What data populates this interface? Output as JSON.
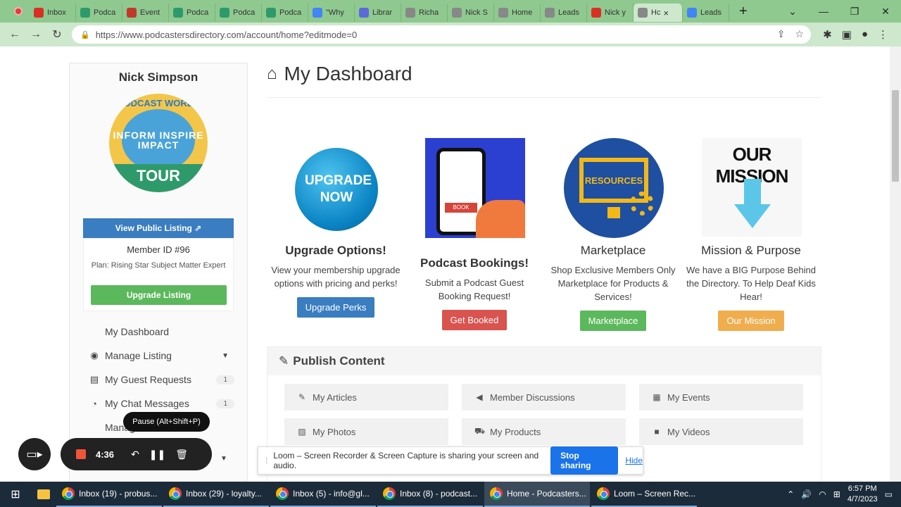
{
  "browser": {
    "tabs": [
      {
        "label": "Inbox",
        "color": "#d93025"
      },
      {
        "label": "Podca",
        "color": "#2e9a6b"
      },
      {
        "label": "Event",
        "color": "#c0392b"
      },
      {
        "label": "Podca",
        "color": "#2e9a6b"
      },
      {
        "label": "Podca",
        "color": "#2e9a6b"
      },
      {
        "label": "Podca",
        "color": "#2e9a6b"
      },
      {
        "label": "\"Why",
        "color": "#4285f4"
      },
      {
        "label": "Librar",
        "color": "#5b6bd8"
      },
      {
        "label": "Richa",
        "color": "#888888"
      },
      {
        "label": "Nick S",
        "color": "#888888"
      },
      {
        "label": "Home",
        "color": "#888888"
      },
      {
        "label": "Leads",
        "color": "#888888"
      },
      {
        "label": "Nick y",
        "color": "#d93025"
      },
      {
        "label": "Hc",
        "color": "#888888",
        "active": true
      },
      {
        "label": "Leads",
        "color": "#4285f4"
      }
    ],
    "url": "https://www.podcastersdirectory.com/account/home?editmode=0",
    "new_tab": "+",
    "close_tab": "×"
  },
  "sidebar": {
    "profile_name": "Nick Simpson",
    "logo": {
      "arc": "PODCAST WORLD",
      "lines": "INFORM INSPIRE IMPACT",
      "tour": "TOUR"
    },
    "view_public_listing": "View Public Listing",
    "member_id": "Member ID #96",
    "plan": "Plan: Rising Star Subject Matter Expert",
    "upgrade_listing": "Upgrade Listing",
    "menu": [
      {
        "label": "My Dashboard",
        "icon": "none"
      },
      {
        "label": "Manage Listing",
        "icon": "user-circle-icon"
      },
      {
        "label": "My Guest Requests",
        "icon": "id-card-icon",
        "badge": "1"
      },
      {
        "label": "My Chat Messages",
        "icon": "chat-icon",
        "badge": "1"
      },
      {
        "label": "Manage Reviews",
        "icon": "none"
      }
    ]
  },
  "main": {
    "title": "My Dashboard",
    "cards": [
      {
        "image_text": "UPGRADE NOW",
        "title": "Upgrade Options!",
        "desc": "View your membership upgrade options with pricing and perks!",
        "button": "Upgrade Perks",
        "color": "#3a7dc0"
      },
      {
        "image_text": "BOOK",
        "title": "Podcast Bookings!",
        "desc": "Submit a Podcast Guest Booking Request!",
        "button": "Get Booked",
        "color": "#d9534f"
      },
      {
        "image_text": "RESOURCES",
        "title": "Marketplace",
        "desc": "Shop Exclusive Members Only Marketplace for Products & Services!",
        "button": "Marketplace",
        "color": "#5cb85c"
      },
      {
        "image_text": "OUR MISSION",
        "title": "Mission & Purpose",
        "desc": "We have a BIG Purpose Behind the Directory. To Help Deaf Kids Hear!",
        "button": "Our Mission",
        "color": "#f0ad4e"
      }
    ],
    "publish": {
      "title": "Publish Content",
      "items": [
        {
          "label": "My Articles"
        },
        {
          "label": "Member Discussions"
        },
        {
          "label": "My Events"
        },
        {
          "label": "My Photos"
        },
        {
          "label": "My Products"
        },
        {
          "label": "My Videos"
        }
      ]
    }
  },
  "loom": {
    "timer": "4:36",
    "tooltip": "Pause (Alt+Shift+P)",
    "share_message": "Loom – Screen Recorder & Screen Capture is sharing your screen and audio.",
    "stop_sharing": "Stop sharing",
    "hide": "Hide"
  },
  "taskbar": {
    "items": [
      {
        "label": "Inbox (19) - probus..."
      },
      {
        "label": "Inbox (29) - loyalty..."
      },
      {
        "label": "Inbox (5) - info@gl..."
      },
      {
        "label": "Inbox (8) - podcast..."
      },
      {
        "label": "Home - Podcasters...",
        "active": true
      },
      {
        "label": "Loom – Screen Rec..."
      }
    ],
    "time": "6:57 PM",
    "date": "4/7/2023"
  }
}
